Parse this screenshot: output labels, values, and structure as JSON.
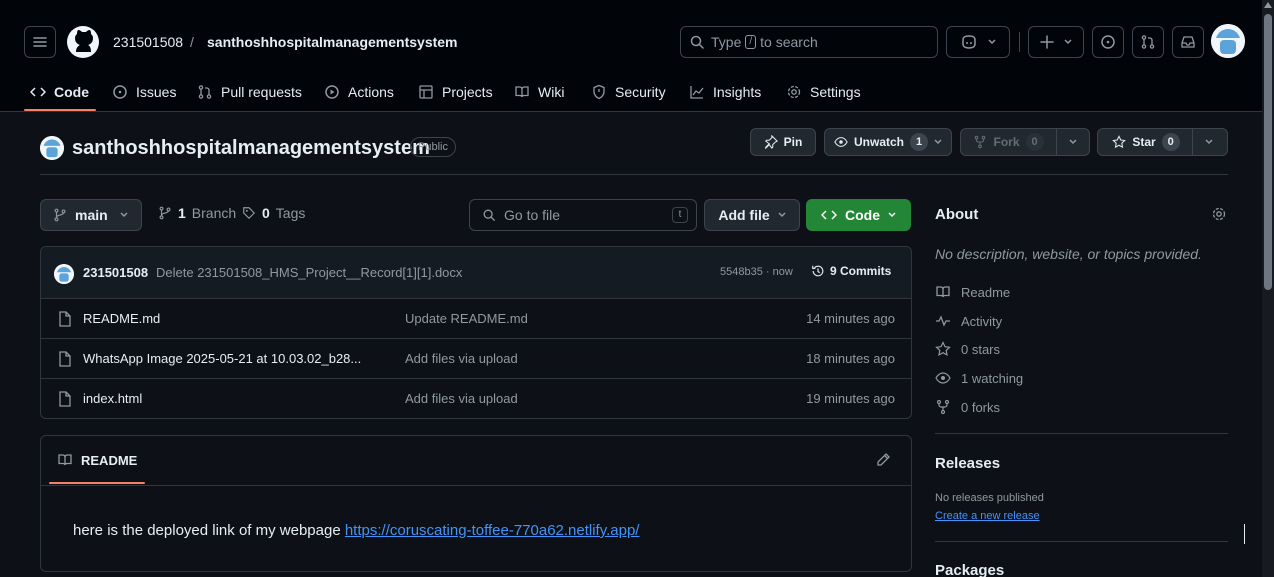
{
  "header": {
    "owner": "231501508",
    "separator": "/",
    "repo": "santhoshhospitalmanagementsystem",
    "search": {
      "prefix": "Type",
      "key": "/",
      "suffix": "to search"
    },
    "icons": [
      "hamburger-icon",
      "github-logo",
      "copilot-icon",
      "plus-icon",
      "issue-icon",
      "pull-request-icon",
      "inbox-icon",
      "avatar"
    ]
  },
  "tabs": [
    {
      "label": "Code",
      "icon": "code-icon",
      "active": true
    },
    {
      "label": "Issues",
      "icon": "issue-icon"
    },
    {
      "label": "Pull requests",
      "icon": "pull-request-icon"
    },
    {
      "label": "Actions",
      "icon": "play-icon"
    },
    {
      "label": "Projects",
      "icon": "table-icon"
    },
    {
      "label": "Wiki",
      "icon": "book-icon"
    },
    {
      "label": "Security",
      "icon": "shield-icon"
    },
    {
      "label": "Insights",
      "icon": "graph-icon"
    },
    {
      "label": "Settings",
      "icon": "gear-icon"
    }
  ],
  "repo_header": {
    "name": "santhoshhospitalmanagementsystem",
    "visibility": "Public",
    "pin_label": "Pin",
    "unwatch_label": "Unwatch",
    "watch_count": "1",
    "fork_label": "Fork",
    "fork_count": "0",
    "star_label": "Star",
    "star_count": "0"
  },
  "toolbar": {
    "branch": "main",
    "branches_count": "1",
    "branches_label": "Branch",
    "tags_count": "0",
    "tags_label": "Tags",
    "goto_placeholder": "Go to file",
    "goto_key": "t",
    "add_file_label": "Add file",
    "code_label": "Code"
  },
  "latest_commit": {
    "author": "231501508",
    "message": "Delete 231501508_HMS_Project__Record[1][1].docx",
    "hash": "5548b35 · now",
    "commits_count": "9 Commits"
  },
  "files": [
    {
      "name": "README.md",
      "message": "Update README.md",
      "time": "14 minutes ago"
    },
    {
      "name": "WhatsApp Image 2025-05-21 at 10.03.02_b28...",
      "message": "Add files via upload",
      "time": "18 minutes ago"
    },
    {
      "name": "index.html",
      "message": "Add files via upload",
      "time": "19 minutes ago"
    }
  ],
  "readme": {
    "tab_label": "README",
    "text": "here is the deployed link of my webpage ",
    "link": "https://coruscating-toffee-770a62.netlify.app/"
  },
  "about": {
    "title": "About",
    "description": "No description, website, or topics provided.",
    "items": [
      {
        "icon": "book-icon",
        "label": "Readme"
      },
      {
        "icon": "pulse-icon",
        "label": "Activity"
      },
      {
        "icon": "star-icon",
        "label": "0 stars"
      },
      {
        "icon": "eye-icon",
        "label": "1 watching"
      },
      {
        "icon": "fork-icon",
        "label": "0 forks"
      }
    ]
  },
  "releases": {
    "title": "Releases",
    "none_text": "No releases published",
    "create_link": "Create a new release"
  },
  "packages": {
    "title": "Packages"
  },
  "colors": {
    "background": "#0d1117",
    "header_bg": "#010409",
    "border": "#30363d",
    "accent_underline": "#f78166",
    "primary_button": "#238636",
    "link": "#4493f8",
    "muted_text": "#9198a1"
  }
}
